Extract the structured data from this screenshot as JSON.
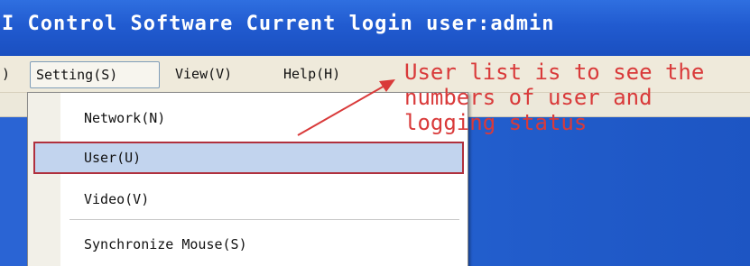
{
  "window": {
    "title": "I Control Software Current login user:admin"
  },
  "menubar": {
    "items": [
      {
        "label": ")"
      },
      {
        "label": "Setting(S)"
      },
      {
        "label": "View(V)"
      },
      {
        "label": "Help(H)"
      }
    ]
  },
  "dropdown": {
    "items": [
      {
        "label": "Network(N)"
      },
      {
        "label": "User(U)"
      },
      {
        "label": "Video(V)"
      },
      {
        "label": "Synchronize Mouse(S)"
      }
    ],
    "selected": "User(U)"
  },
  "annotation": {
    "text": "User list is to see the\nnumbers of user and\nlogging status",
    "color": "#d93a3a"
  },
  "colors": {
    "titlebar": "#215bd0",
    "menubar": "#efeadb",
    "desktop": "#2461d0",
    "highlight": "#c2d4ee",
    "highlight_border": "#b0303d"
  }
}
